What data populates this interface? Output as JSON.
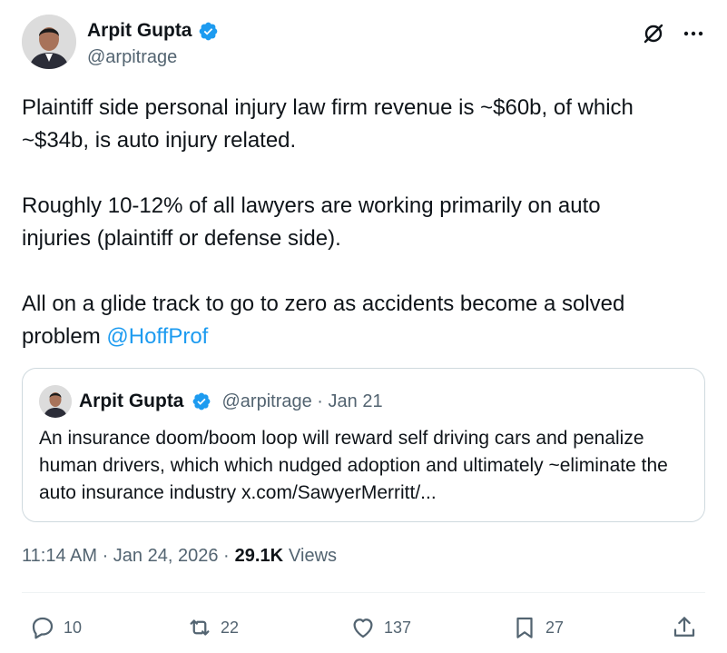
{
  "author": {
    "name": "Arpit Gupta",
    "handle": "@arpitrage"
  },
  "tweet": {
    "text_before_mention": "Plaintiff side personal injury law firm revenue is ~$60b, of which\n~$34b, is auto injury related.\n\nRoughly 10-12% of all lawyers are working primarily on auto\ninjuries (plaintiff or defense side).\n\nAll on a glide track to go to zero as accidents become a solved\nproblem ",
    "mention": "@HoffProf"
  },
  "quote": {
    "name": "Arpit Gupta",
    "handle_date": "@arpitrage · Jan 21",
    "text": "An insurance doom/boom loop will reward self driving cars and penalize human drivers, which which nudged adoption and ultimately ~eliminate the auto insurance industry x.com/SawyerMerritt/..."
  },
  "meta": {
    "time_date": "11:14 AM · Jan 24, 2026 ·",
    "views_count": "29.1K",
    "views_label": "Views"
  },
  "actions": {
    "replies": "10",
    "reposts": "22",
    "likes": "137",
    "bookmarks": "27"
  },
  "colors": {
    "accent": "#1d9bf0",
    "text": "#0f1419",
    "muted": "#536471",
    "border": "#cfd9de"
  },
  "icons": [
    "verified-badge-icon",
    "grok-icon",
    "more-icon",
    "reply-icon",
    "repost-icon",
    "like-icon",
    "bookmark-icon",
    "share-icon"
  ]
}
